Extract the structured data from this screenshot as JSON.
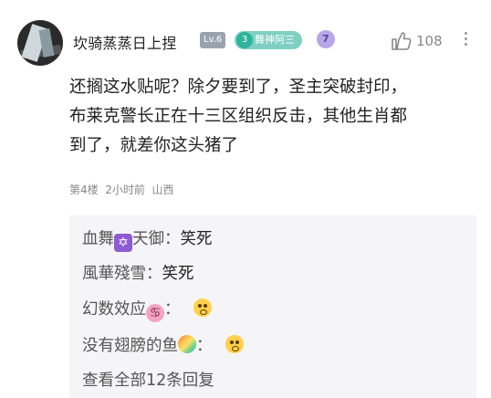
{
  "comment": {
    "username": "坎骑蒸蒸日上捏",
    "level": "Lv.6",
    "badge": {
      "number": "3",
      "label": "舞神阿三"
    },
    "purple_badge": "7",
    "likes": "108",
    "text_lines": [
      "还搁这水贴呢？除夕要到了，圣主突破封印，",
      "布莱克警长正在十三区组织反击，其他生肖都",
      "到了，就差你这头猪了"
    ],
    "meta": "第4楼  2小时前  山西"
  },
  "replies": [
    {
      "name_a": "血舞",
      "icon": "✡",
      "name_b": "天御",
      "sep": "：",
      "text": "笑死"
    },
    {
      "name_a": "風華殘雪",
      "sep": "：",
      "text": "笑死"
    },
    {
      "name_a": "幻数效应",
      "icon": "♋",
      "sep": "："
    },
    {
      "name_a": "没有翅膀的鱼",
      "sep": "："
    }
  ],
  "view_all": "查看全部12条回复",
  "icons": [
    "avatar",
    "thumbs-up-icon",
    "more-icon",
    "star-of-david-icon",
    "cancer-icon",
    "rainbow-icon",
    "astonished-face-icon"
  ]
}
